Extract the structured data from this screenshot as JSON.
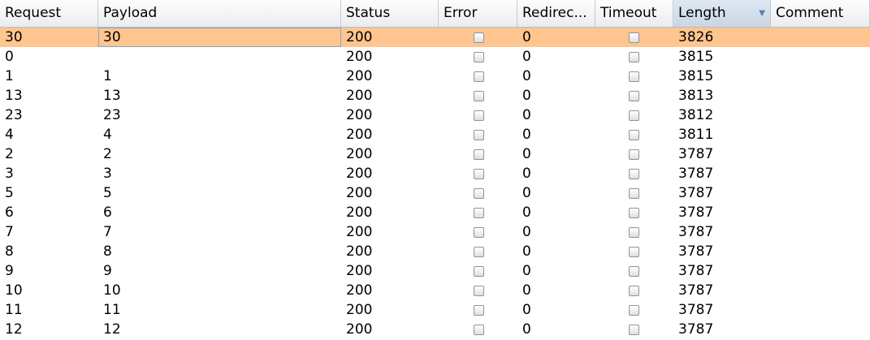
{
  "columns": {
    "request": "Request",
    "payload": "Payload",
    "status": "Status",
    "error": "Error",
    "redirects": "Redirec...",
    "timeout": "Timeout",
    "length": "Length",
    "comment": "Comment"
  },
  "sort_indicator": "▼",
  "rows": [
    {
      "request": "30",
      "payload": "30",
      "status": "200",
      "redirects": "0",
      "length": "3826",
      "error": false,
      "timeout": false
    },
    {
      "request": "0",
      "payload": "",
      "status": "200",
      "redirects": "0",
      "length": "3815",
      "error": false,
      "timeout": false
    },
    {
      "request": "1",
      "payload": "1",
      "status": "200",
      "redirects": "0",
      "length": "3815",
      "error": false,
      "timeout": false
    },
    {
      "request": "13",
      "payload": "13",
      "status": "200",
      "redirects": "0",
      "length": "3813",
      "error": false,
      "timeout": false
    },
    {
      "request": "23",
      "payload": "23",
      "status": "200",
      "redirects": "0",
      "length": "3812",
      "error": false,
      "timeout": false
    },
    {
      "request": "4",
      "payload": "4",
      "status": "200",
      "redirects": "0",
      "length": "3811",
      "error": false,
      "timeout": false
    },
    {
      "request": "2",
      "payload": "2",
      "status": "200",
      "redirects": "0",
      "length": "3787",
      "error": false,
      "timeout": false
    },
    {
      "request": "3",
      "payload": "3",
      "status": "200",
      "redirects": "0",
      "length": "3787",
      "error": false,
      "timeout": false
    },
    {
      "request": "5",
      "payload": "5",
      "status": "200",
      "redirects": "0",
      "length": "3787",
      "error": false,
      "timeout": false
    },
    {
      "request": "6",
      "payload": "6",
      "status": "200",
      "redirects": "0",
      "length": "3787",
      "error": false,
      "timeout": false
    },
    {
      "request": "7",
      "payload": "7",
      "status": "200",
      "redirects": "0",
      "length": "3787",
      "error": false,
      "timeout": false
    },
    {
      "request": "8",
      "payload": "8",
      "status": "200",
      "redirects": "0",
      "length": "3787",
      "error": false,
      "timeout": false
    },
    {
      "request": "9",
      "payload": "9",
      "status": "200",
      "redirects": "0",
      "length": "3787",
      "error": false,
      "timeout": false
    },
    {
      "request": "10",
      "payload": "10",
      "status": "200",
      "redirects": "0",
      "length": "3787",
      "error": false,
      "timeout": false
    },
    {
      "request": "11",
      "payload": "11",
      "status": "200",
      "redirects": "0",
      "length": "3787",
      "error": false,
      "timeout": false
    },
    {
      "request": "12",
      "payload": "12",
      "status": "200",
      "redirects": "0",
      "length": "3787",
      "error": false,
      "timeout": false
    }
  ],
  "colors": {
    "selected_row": "#ffc58f",
    "sorted_header": "#c9d6e5",
    "sort_arrow": "#5a7fb0"
  }
}
